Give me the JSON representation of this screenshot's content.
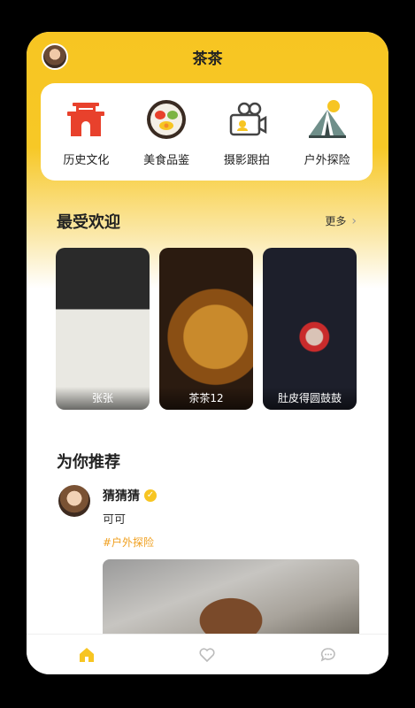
{
  "app": {
    "title": "茶茶"
  },
  "categories": [
    {
      "label": "历史文化",
      "icon": "gate-icon"
    },
    {
      "label": "美食品鉴",
      "icon": "food-plate-icon"
    },
    {
      "label": "摄影跟拍",
      "icon": "camera-icon"
    },
    {
      "label": "户外探险",
      "icon": "tent-icon"
    }
  ],
  "popular": {
    "title": "最受欢迎",
    "more_label": "更多",
    "items": [
      {
        "name": "张张"
      },
      {
        "name": "茶茶12"
      },
      {
        "name": "肚皮得圆鼓鼓"
      }
    ]
  },
  "recommend": {
    "title": "为你推荐",
    "post": {
      "username": "猜猜猜",
      "text": "可可",
      "tag": "#户外探险"
    }
  },
  "tabs": [
    {
      "name": "home",
      "icon": "home-icon",
      "active": true
    },
    {
      "name": "favorites",
      "icon": "heart-icon",
      "active": false
    },
    {
      "name": "messages",
      "icon": "chat-icon",
      "active": false
    }
  ],
  "colors": {
    "accent": "#f7c522",
    "tag": "#f0a020"
  }
}
